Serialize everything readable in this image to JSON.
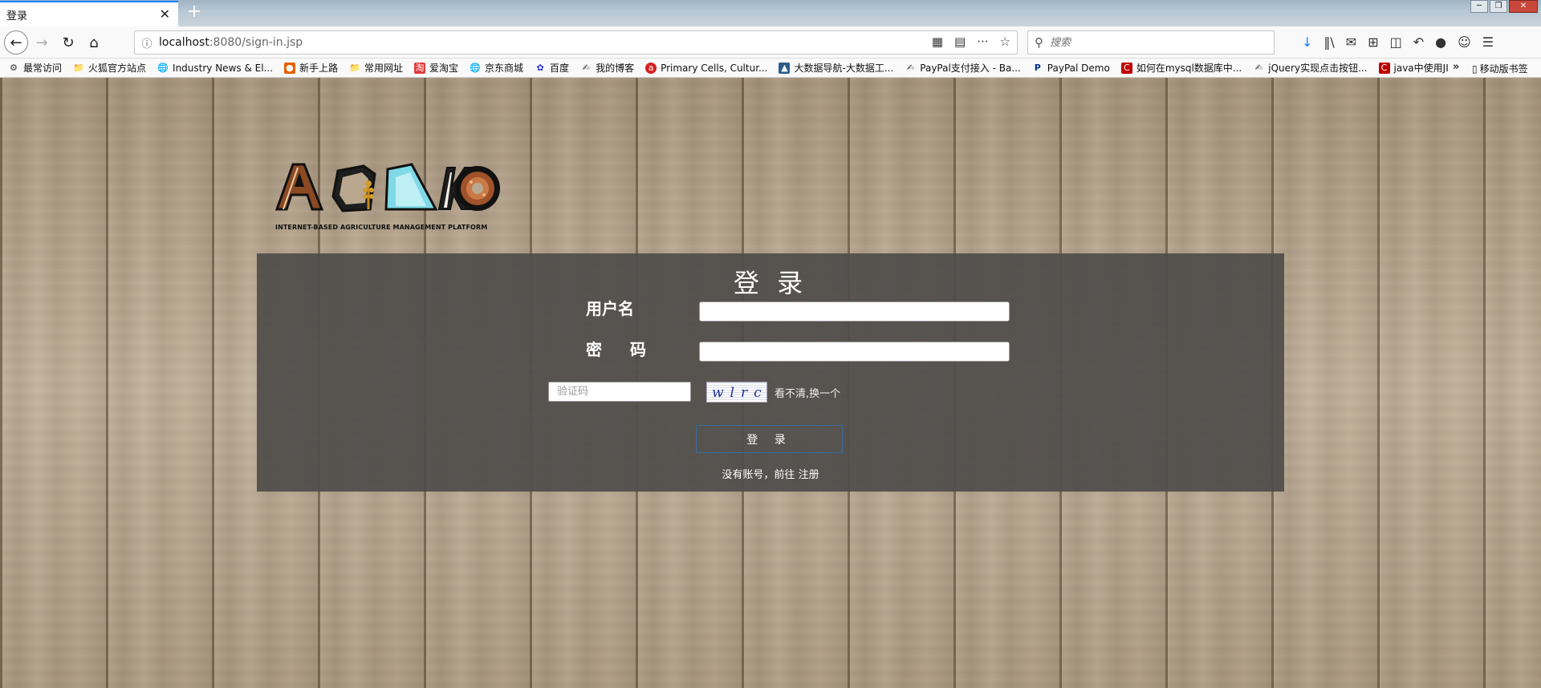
{
  "browser": {
    "tab_title": "登录",
    "tab_close": "✕",
    "new_tab": "+",
    "url_host": "localhost",
    "url_path": ":8080/sign-in.jsp",
    "search_placeholder": "搜索",
    "window_controls": [
      "─",
      "❐",
      "✕"
    ]
  },
  "bookmarks": [
    {
      "label": "最常访问",
      "icon": "gear-icon",
      "color": "#555555"
    },
    {
      "label": "火狐官方站点",
      "icon": "folder-icon",
      "color": "#777777"
    },
    {
      "label": "Industry News & El...",
      "icon": "globe-icon",
      "color": "#666666"
    },
    {
      "label": "新手上路",
      "icon": "firefox-icon",
      "color": "#e66000"
    },
    {
      "label": "常用网址",
      "icon": "folder-icon",
      "color": "#777777"
    },
    {
      "label": "爱淘宝",
      "icon": "taobao-icon",
      "color": "#e4393c"
    },
    {
      "label": "京东商城",
      "icon": "globe-icon",
      "color": "#666666"
    },
    {
      "label": "百度",
      "icon": "baidu-icon",
      "color": "#2932e1"
    },
    {
      "label": "我的博客",
      "icon": "blog-icon",
      "color": "#444444"
    },
    {
      "label": "Primary Cells, Cultur...",
      "icon": "atcc-icon",
      "color": "#d42020"
    },
    {
      "label": "大数据导航-大数据工...",
      "icon": "bigdata-icon",
      "color": "#2b5d8a"
    },
    {
      "label": "PayPal支付接入 - Ba...",
      "icon": "blog-icon",
      "color": "#444444"
    },
    {
      "label": "PayPal Demo",
      "icon": "paypal-icon",
      "color": "#003087"
    },
    {
      "label": "如何在mysql数据库中...",
      "icon": "csdn-icon",
      "color": "#c00000"
    },
    {
      "label": "jQuery实现点击按钮...",
      "icon": "blog-icon",
      "color": "#444444"
    },
    {
      "label": "java中使用JI",
      "icon": "csdn-icon",
      "color": "#c00000"
    }
  ],
  "bookmarks_more": "»",
  "bookmarks_mobile": "移动版书签",
  "logo": {
    "tagline": "INTERNET-BASED AGRICULTURE MANAGEMENT PLATFORM"
  },
  "login": {
    "title": "登 录",
    "username_label": "用户名",
    "password_label": "密 码",
    "username_value": "",
    "password_value": "",
    "captcha_placeholder": "验证码",
    "captcha_text": "wlrc",
    "captcha_refresh": "看不清,换一个",
    "submit_label": "登 录",
    "register_prefix": "没有账号，前往 ",
    "register_link": "注册"
  },
  "colors": {
    "panel_bg": "#504c4a",
    "accent": "#0a84ff",
    "button_border": "#3a6c9a"
  }
}
